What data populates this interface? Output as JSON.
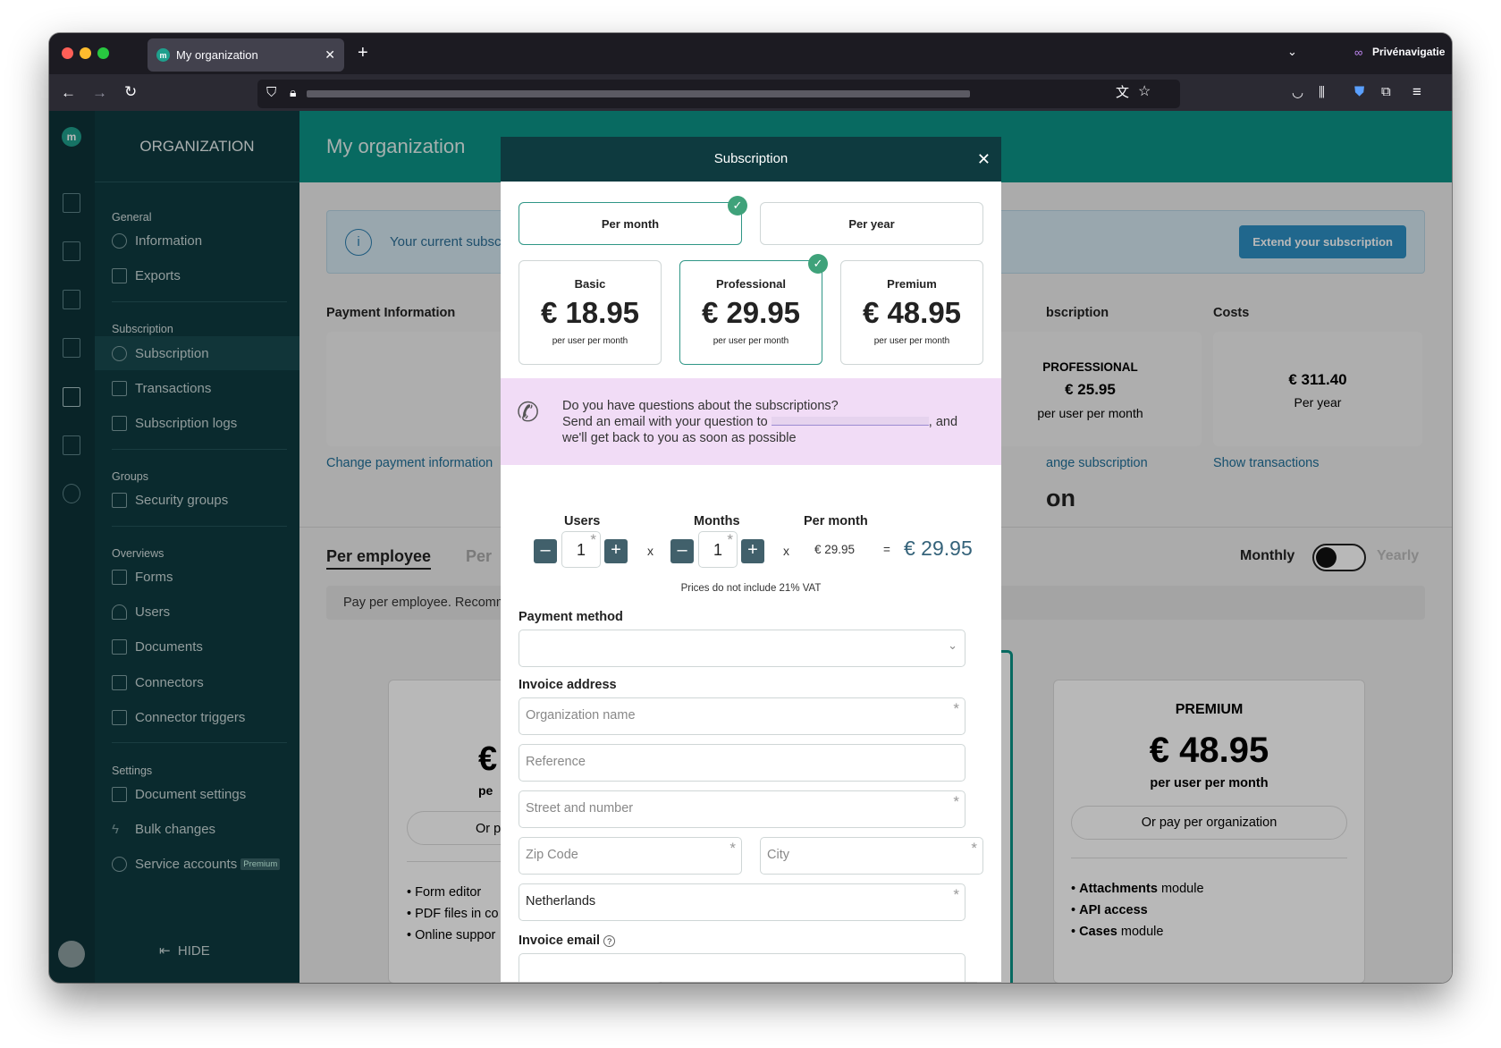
{
  "browser": {
    "tab_title": "My organization",
    "private_label": "Privénavigatie"
  },
  "sidebar": {
    "title": "ORGANIZATION",
    "hide_label": "HIDE",
    "sections": {
      "general": "General",
      "subscription": "Subscription",
      "groups": "Groups",
      "overviews": "Overviews",
      "settings": "Settings"
    },
    "items": {
      "information": "Information",
      "exports": "Exports",
      "subscription": "Subscription",
      "transactions": "Transactions",
      "subscription_logs": "Subscription logs",
      "security_groups": "Security groups",
      "forms": "Forms",
      "users": "Users",
      "documents": "Documents",
      "connectors": "Connectors",
      "connector_triggers": "Connector triggers",
      "document_settings": "Document settings",
      "bulk_changes": "Bulk changes",
      "service_accounts": "Service accounts",
      "premium_badge": "Premium"
    }
  },
  "background": {
    "page_title": "My organization",
    "banner_text": "Your current subsc",
    "extend_button": "Extend your subscription",
    "payment_info_heading": "Payment Information",
    "subscription_heading": "bscription",
    "costs_heading": "Costs",
    "plan_name": "PROFESSIONAL",
    "plan_price": "€ 25.95",
    "plan_unit": "per user per month",
    "cost_value": "€ 311.40",
    "cost_period": "Per year",
    "change_payment_link": "Change payment information",
    "change_subscription_link": "ange subscription",
    "show_transactions_link": "Show transactions",
    "section_fragment": "on",
    "tab_per_employee": "Per employee",
    "tab_per_other": "Per",
    "monthly_label": "Monthly",
    "yearly_label": "Yearly",
    "note_text": "Pay per employee. Recomm",
    "left_card_price": "€",
    "left_card_unit": "pe",
    "left_card_button": "Or p",
    "left_features": [
      "Form editor",
      "PDF files in co",
      "Online suppor"
    ],
    "premium_title": "PREMIUM",
    "premium_price": "€ 48.95",
    "premium_unit": "per user per month",
    "premium_button": "Or pay per organization",
    "premium_features": [
      {
        "bold": "Attachments",
        "rest": " module"
      },
      {
        "bold": "API access",
        "rest": ""
      },
      {
        "bold": "Cases",
        "rest": " module"
      }
    ]
  },
  "modal": {
    "title": "Subscription",
    "period_month": "Per month",
    "period_year": "Per year",
    "plans": [
      {
        "name": "Basic",
        "price": "€ 18.95",
        "unit": "per user per month"
      },
      {
        "name": "Professional",
        "price": "€ 29.95",
        "unit": "per user per month"
      },
      {
        "name": "Premium",
        "price": "€ 48.95",
        "unit": "per user per month"
      }
    ],
    "info_line1": "Do you have questions about the subscriptions?",
    "info_line2_pre": "Send an email with your question to",
    "info_line2_post": ", and",
    "info_line3": "we'll get back to you as soon as possible",
    "calc": {
      "users_label": "Users",
      "months_label": "Months",
      "per_month_label": "Per month",
      "users_value": "1",
      "months_value": "1",
      "times": "x",
      "equals": "=",
      "per_month_value": "€ 29.95",
      "total": "€ 29.95"
    },
    "vat_note": "Prices do not include 21% VAT",
    "payment_method_label": "Payment method",
    "invoice_address_label": "Invoice address",
    "fields": {
      "org_name": "Organization name",
      "reference": "Reference",
      "street": "Street and number",
      "zip": "Zip Code",
      "city": "City",
      "country": "Netherlands"
    },
    "invoice_email_label": "Invoice email"
  },
  "colors": {
    "accent": "#0c9387",
    "sidebar": "#0f3b40",
    "check": "#3fa27a"
  }
}
